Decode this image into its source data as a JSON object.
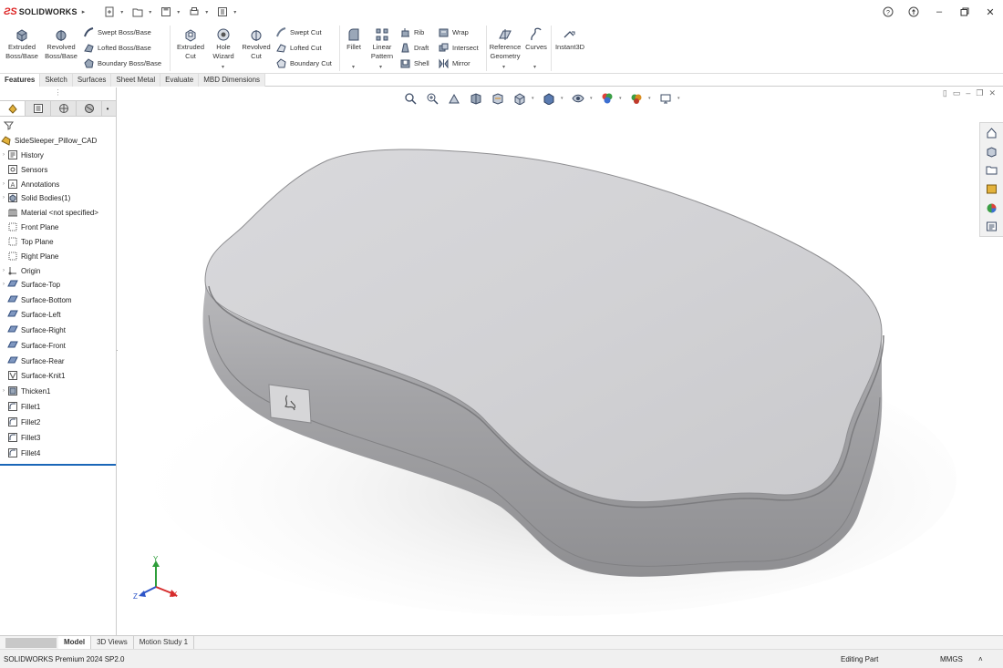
{
  "app": {
    "brand_prefix": "3DS",
    "brand_name": "SOLIDWORKS"
  },
  "ribbon": {
    "extruded_boss": "Extruded Boss/Base",
    "revolved_boss": "Revolved Boss/Base",
    "swept_boss": "Swept Boss/Base",
    "lofted_boss": "Lofted Boss/Base",
    "boundary_boss": "Boundary Boss/Base",
    "extruded_cut": "Extruded Cut",
    "hole_wizard": "Hole Wizard",
    "revolved_cut": "Revolved Cut",
    "swept_cut": "Swept Cut",
    "lofted_cut": "Lofted Cut",
    "boundary_cut": "Boundary Cut",
    "fillet": "Fillet",
    "linear_pattern": "Linear Pattern",
    "rib": "Rib",
    "draft": "Draft",
    "shell": "Shell",
    "wrap": "Wrap",
    "intersect": "Intersect",
    "mirror": "Mirror",
    "reference_geometry": "Reference Geometry",
    "curves": "Curves",
    "instant3d": "Instant3D"
  },
  "command_tabs": [
    "Features",
    "Sketch",
    "Surfaces",
    "Sheet Metal",
    "Evaluate",
    "MBD Dimensions"
  ],
  "feature_tree": {
    "root": "SideSleeper_Pillow_CAD",
    "nodes": [
      {
        "label": "History",
        "icon": "history-icon",
        "expandable": true
      },
      {
        "label": "Sensors",
        "icon": "sensor-icon",
        "expandable": false
      },
      {
        "label": "Annotations",
        "icon": "annotation-icon",
        "expandable": true
      },
      {
        "label": "Solid Bodies(1)",
        "icon": "solid-bodies-icon",
        "expandable": true
      },
      {
        "label": "Material <not specified>",
        "icon": "material-icon",
        "expandable": false
      },
      {
        "label": "Front Plane",
        "icon": "plane-icon",
        "expandable": false
      },
      {
        "label": "Top Plane",
        "icon": "plane-icon",
        "expandable": false
      },
      {
        "label": "Right Plane",
        "icon": "plane-icon",
        "expandable": false
      },
      {
        "label": "Origin",
        "icon": "origin-icon",
        "expandable": true
      },
      {
        "label": "Surface-Top",
        "icon": "surface-icon",
        "expandable": true
      },
      {
        "label": "Surface-Bottom",
        "icon": "surface-icon",
        "expandable": false
      },
      {
        "label": "Surface-Left",
        "icon": "surface-icon",
        "expandable": false
      },
      {
        "label": "Surface-Right",
        "icon": "surface-icon",
        "expandable": false
      },
      {
        "label": "Surface-Front",
        "icon": "surface-icon",
        "expandable": false
      },
      {
        "label": "Surface-Rear",
        "icon": "surface-icon",
        "expandable": false
      },
      {
        "label": "Surface-Knit1",
        "icon": "knit-icon",
        "expandable": false
      },
      {
        "label": "Thicken1",
        "icon": "thicken-icon",
        "expandable": true
      },
      {
        "label": "Fillet1",
        "icon": "fillet-icon",
        "expandable": false
      },
      {
        "label": "Fillet2",
        "icon": "fillet-icon",
        "expandable": false
      },
      {
        "label": "Fillet3",
        "icon": "fillet-icon",
        "expandable": false
      },
      {
        "label": "Fillet4",
        "icon": "fillet-icon",
        "expandable": false
      }
    ]
  },
  "triad": {
    "y": "Y",
    "x": "X",
    "z": "Z"
  },
  "bottom_tabs": [
    "Model",
    "3D Views",
    "Motion Study 1"
  ],
  "status": {
    "product": "SOLIDWORKS Premium 2024 SP2.0",
    "mode": "Editing Part",
    "units": "MMGS"
  },
  "colors": {
    "brand_red": "#d22222",
    "selection_blue": "#1a66b8",
    "model_gray": "#d4d4d6"
  }
}
